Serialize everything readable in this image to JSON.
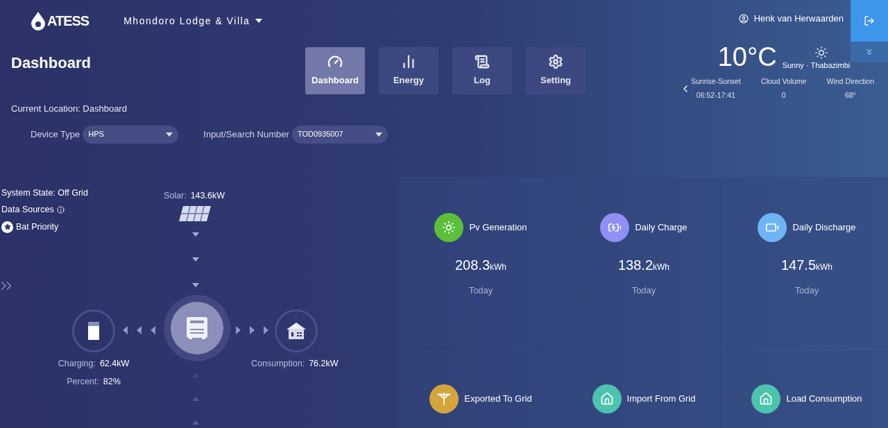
{
  "header": {
    "logo": "ATESS",
    "site": "Mhondoro Lodge & Villa",
    "user": "Henk van Herwaarden"
  },
  "page_title": "Dashboard",
  "nav_tabs": [
    {
      "label": "Dashboard",
      "kind": "gauge",
      "selected": true
    },
    {
      "label": "Energy",
      "kind": "bars",
      "selected": false
    },
    {
      "label": "Log",
      "kind": "log",
      "selected": false
    },
    {
      "label": "Setting",
      "kind": "gear",
      "selected": false
    }
  ],
  "weather": {
    "temperature": "10°C",
    "condition": "Sunny · Thabazimbi",
    "details": [
      {
        "label": "Sunrise-Sunset",
        "value": "06:52-17:41"
      },
      {
        "label": "Cloud Volume",
        "value": "0"
      },
      {
        "label": "Wind Direction",
        "value": "68°"
      }
    ]
  },
  "breadcrumb": "Current Location: Dashboard",
  "filters": [
    {
      "label": "Device Type",
      "value": "HPS"
    },
    {
      "label": "Input/Search Number",
      "value": "TOD0935007"
    }
  ],
  "system": {
    "state_label": "System State:",
    "state": "Off Grid",
    "data_sources": "Data Sources",
    "mode": "Bat Priority"
  },
  "flow": {
    "solar": {
      "label": "Solar:",
      "value": "143.6kW"
    },
    "battery": [
      {
        "label": "Charging:",
        "value": "62.4kW"
      },
      {
        "label": "Percent:",
        "value": "82%"
      }
    ],
    "load": {
      "label": "Consumption:",
      "value": "76.2kW"
    }
  },
  "stats": [
    {
      "kind": "pv",
      "label": "Pv Generation",
      "value": "208.3",
      "unit": "kWh",
      "period": "Today",
      "color": "#5bbf3a"
    },
    {
      "kind": "charge",
      "label": "Daily Charge",
      "value": "138.2",
      "unit": "kWh",
      "period": "Today",
      "color": "#8f8ff5"
    },
    {
      "kind": "discharge",
      "label": "Daily Discharge",
      "value": "147.5",
      "unit": "kWh",
      "period": "Today",
      "color": "#6fb4f5"
    },
    {
      "kind": "export",
      "label": "Exported To Grid",
      "color": "#d4a53a"
    },
    {
      "kind": "import",
      "label": "Import From Grid",
      "color": "#4cc3ad"
    },
    {
      "kind": "load",
      "label": "Load Consumption",
      "color": "#4cc3ad"
    }
  ]
}
